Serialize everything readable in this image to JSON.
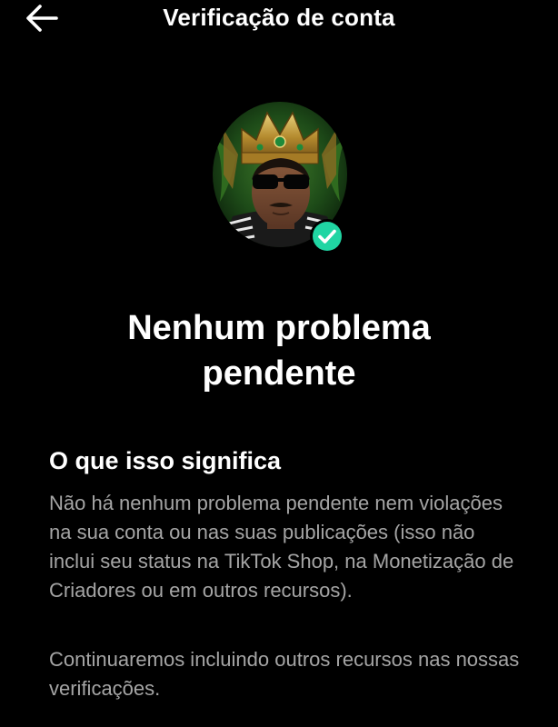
{
  "header": {
    "title": "Verificação de conta",
    "back_icon": "arrow-left-icon"
  },
  "profile": {
    "avatar_icon": "crowned-avatar-image",
    "badge_icon": "check-circle-icon",
    "badge_color": "#20d5a3"
  },
  "status": {
    "line1": "Nenhum problema",
    "line2": "pendente"
  },
  "info": {
    "heading": "O que isso significa",
    "paragraph1": "Não há nenhum problema pendente nem violações na sua conta ou nas suas publicações (isso não inclui seu status na TikTok Shop, na Monetização de Criadores ou em outros recursos).",
    "paragraph2": "Continuaremos incluindo outros recursos nas nossas verificações."
  },
  "colors": {
    "background": "#000000",
    "primary_text": "#ffffff",
    "secondary_text": "#a5a5a5"
  }
}
